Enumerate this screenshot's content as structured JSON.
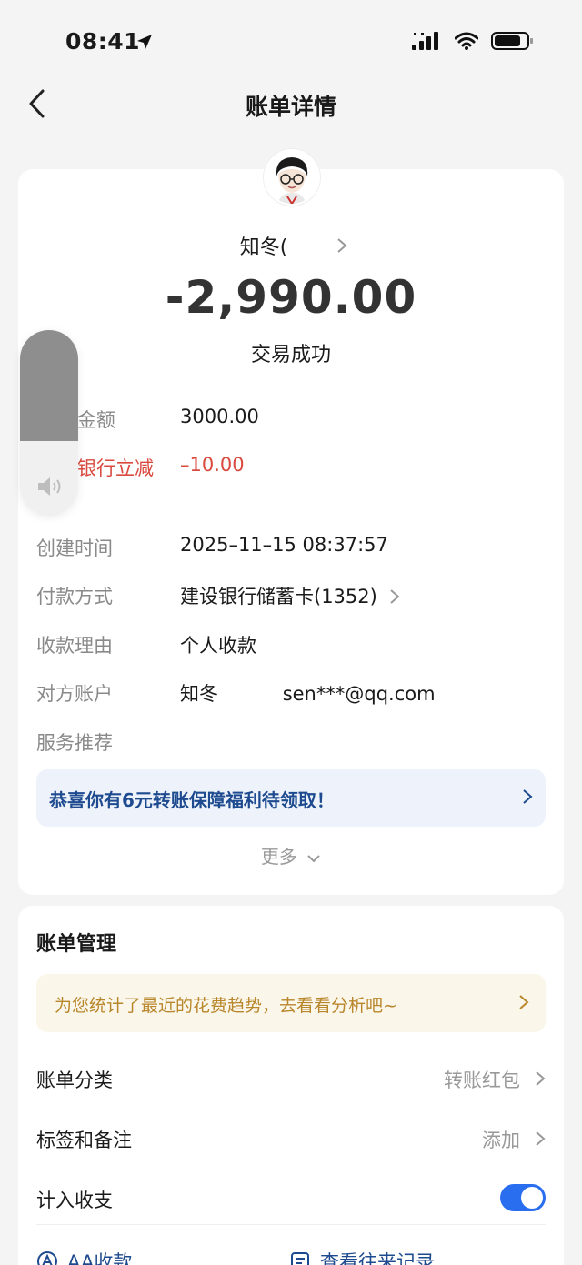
{
  "status_bar": {
    "time": "08:41"
  },
  "nav": {
    "title": "账单详情"
  },
  "payee": {
    "name": "知冬("
  },
  "transaction": {
    "amount": "-2,990.00",
    "status": "交易成功"
  },
  "details": [
    {
      "label": "金额",
      "value": "3000.00"
    },
    {
      "label": "银行立减",
      "value": "–10.00"
    },
    {
      "label": "创建时间",
      "value": "2025–11–15 08:37:57"
    },
    {
      "label": "付款方式",
      "value": "建设银行储蓄卡(1352)"
    },
    {
      "label": "收款理由",
      "value": "个人收款"
    },
    {
      "label": "对方账户",
      "value_name": "知冬",
      "value_email": "sen***@qq.com"
    },
    {
      "label": "服务推荐"
    }
  ],
  "promo": {
    "text": "恭喜你有6元转账保障福利待领取！"
  },
  "more": {
    "label": "更多"
  },
  "management": {
    "title": "账单管理",
    "tip": "为您统计了最近的花费趋势，去看看分析吧~",
    "rows": [
      {
        "label": "账单分类",
        "value": "转账红包"
      },
      {
        "label": "标签和备注",
        "value": "添加"
      },
      {
        "label": "计入收支",
        "toggle": true
      }
    ]
  },
  "bottom_actions": [
    {
      "label": "AA收款"
    },
    {
      "label": "查看往来记录"
    }
  ],
  "colors": {
    "accent": "#2a6ef0",
    "discount": "#d94a3f",
    "promo_text": "#1e4b8f",
    "tip_text": "#b8862b"
  }
}
